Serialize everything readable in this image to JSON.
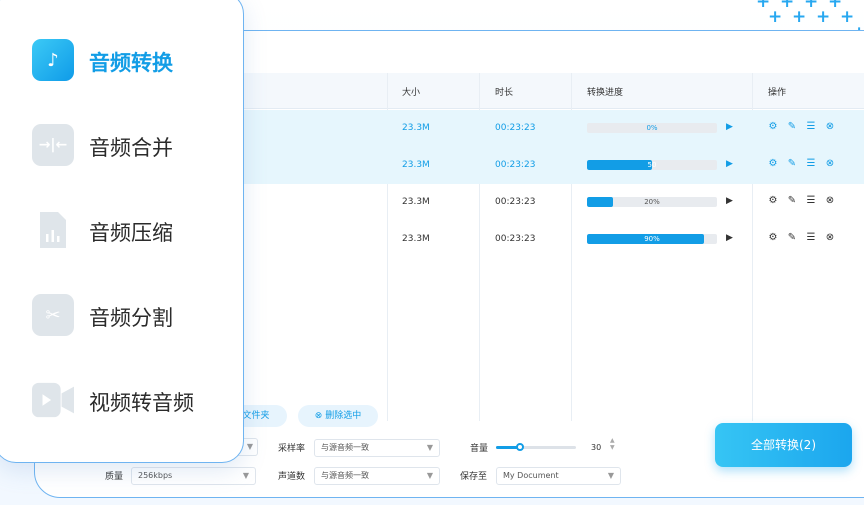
{
  "menu": {
    "items": [
      {
        "label": "音频转换",
        "icon": "music-note-icon",
        "active": true
      },
      {
        "label": "音频合并",
        "icon": "merge-arrows-icon",
        "active": false
      },
      {
        "label": "音频压缩",
        "icon": "compress-file-icon",
        "active": false
      },
      {
        "label": "音频分割",
        "icon": "scissors-icon",
        "active": false
      },
      {
        "label": "视频转音频",
        "icon": "video-camera-icon",
        "active": false
      }
    ]
  },
  "table": {
    "headers": {
      "size": "大小",
      "duration": "时长",
      "progress": "转换进度",
      "actions": "操作"
    },
    "rows": [
      {
        "size": "23.3M",
        "duration": "00:23:23",
        "progress": 0,
        "progress_label": "0%",
        "selected": true
      },
      {
        "size": "23.3M",
        "duration": "00:23:23",
        "progress": 50,
        "progress_label": "50",
        "selected": true
      },
      {
        "size": "23.3M",
        "duration": "00:23:23",
        "progress": 20,
        "progress_label": "20%",
        "selected": false
      },
      {
        "size": "23.3M",
        "duration": "00:23:23",
        "progress": 90,
        "progress_label": "90%",
        "selected": false
      }
    ]
  },
  "toolbar": {
    "add_folder_label": "文件夹",
    "delete_selected_label": "删除选中"
  },
  "settings": {
    "sample_rate_label": "采样率",
    "sample_rate_value": "与源音频一致",
    "volume_label": "音量",
    "volume_value": "30",
    "volume_level": 30,
    "quality_label": "质量",
    "quality_value": "256kbps",
    "channels_label": "声道数",
    "channels_value": "与源音频一致",
    "save_to_label": "保存至",
    "save_to_value": "My Document"
  },
  "convert_all_label": "全部转换(2)",
  "colors": {
    "accent": "#129de6",
    "selected_row": "#e6f6fd",
    "border": "#6fb4f1"
  }
}
